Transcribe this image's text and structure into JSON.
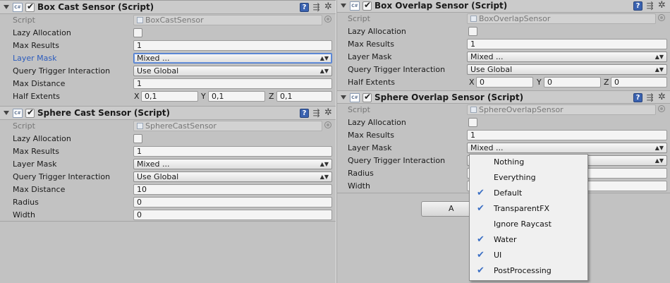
{
  "left": {
    "box_cast": {
      "title": "Box Cast Sensor (Script)",
      "script_label": "Script",
      "script_value": "BoxCastSensor",
      "lazy_label": "Lazy Allocation",
      "max_results_label": "Max Results",
      "max_results": "1",
      "layer_mask_label": "Layer Mask",
      "layer_mask": "Mixed ...",
      "qti_label": "Query Trigger Interaction",
      "qti": "Use Global",
      "max_distance_label": "Max Distance",
      "max_distance": "1",
      "half_extents_label": "Half Extents",
      "x_label": "X",
      "x": "0,1",
      "y_label": "Y",
      "y": "0,1",
      "z_label": "Z",
      "z": "0,1"
    },
    "sphere_cast": {
      "title": "Sphere Cast Sensor (Script)",
      "script_label": "Script",
      "script_value": "SphereCastSensor",
      "lazy_label": "Lazy Allocation",
      "max_results_label": "Max Results",
      "max_results": "1",
      "layer_mask_label": "Layer Mask",
      "layer_mask": "Mixed ...",
      "qti_label": "Query Trigger Interaction",
      "qti": "Use Global",
      "max_distance_label": "Max Distance",
      "max_distance": "10",
      "radius_label": "Radius",
      "radius": "0",
      "width_label": "Width",
      "width": "0"
    }
  },
  "right": {
    "box_overlap": {
      "title": "Box Overlap Sensor (Script)",
      "script_label": "Script",
      "script_value": "BoxOverlapSensor",
      "lazy_label": "Lazy Allocation",
      "max_results_label": "Max Results",
      "max_results": "1",
      "layer_mask_label": "Layer Mask",
      "layer_mask": "Mixed ...",
      "qti_label": "Query Trigger Interaction",
      "qti": "Use Global",
      "half_extents_label": "Half Extents",
      "x_label": "X",
      "x": "0",
      "y_label": "Y",
      "y": "0",
      "z_label": "Z",
      "z": "0"
    },
    "sphere_overlap": {
      "title": "Sphere Overlap Sensor (Script)",
      "script_label": "Script",
      "script_value": "SphereOverlapSensor",
      "lazy_label": "Lazy Allocation",
      "max_results_label": "Max Results",
      "max_results": "1",
      "layer_mask_label": "Layer Mask",
      "layer_mask": "Mixed ...",
      "qti_label": "Query Trigger Interaction",
      "radius_label": "Radius",
      "width_label": "Width",
      "add_button_fragment": "A"
    }
  },
  "layer_menu": {
    "items": [
      {
        "label": "Nothing",
        "checked": false
      },
      {
        "label": "Everything",
        "checked": false
      },
      {
        "label": "Default",
        "checked": true
      },
      {
        "label": "TransparentFX",
        "checked": true
      },
      {
        "label": "Ignore Raycast",
        "checked": false
      },
      {
        "label": "Water",
        "checked": true
      },
      {
        "label": "UI",
        "checked": true
      },
      {
        "label": "PostProcessing",
        "checked": true
      }
    ]
  },
  "icons": {
    "foldout": "triangle-down",
    "script": "cs-script-icon",
    "help": "help-icon",
    "preset": "preset-icon",
    "settings": "gear-icon",
    "object_picker": "target-icon",
    "check": "checkmark"
  },
  "colors": {
    "background": "#c2c2c2",
    "highlight_label": "#2c5cbd",
    "menu_check": "#3b6fc4"
  }
}
